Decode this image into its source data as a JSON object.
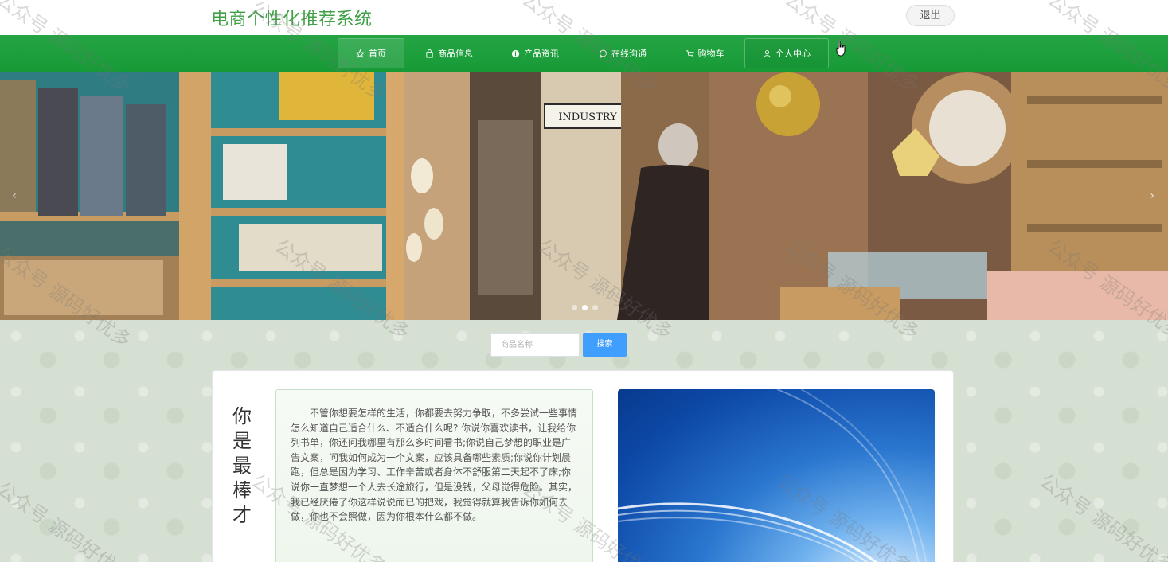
{
  "header": {
    "site_title": "电商个性化推荐系统",
    "logout_label": "退出"
  },
  "nav": {
    "items": [
      {
        "label": "首页",
        "icon": "star-icon",
        "active": true
      },
      {
        "label": "商品信息",
        "icon": "bag-icon"
      },
      {
        "label": "产品资讯",
        "icon": "info-icon"
      },
      {
        "label": "在线沟通",
        "icon": "chat-icon"
      },
      {
        "label": "购物车",
        "icon": "cart-icon"
      },
      {
        "label": "个人中心",
        "icon": "user-icon",
        "boxed": true
      }
    ]
  },
  "banner": {
    "sign_text": "INDUSTRY",
    "prev_glyph": "‹",
    "next_glyph": "›",
    "slide_count": 3,
    "active_slide": 1
  },
  "search": {
    "placeholder": "商品名称",
    "value": "",
    "button_label": "搜索"
  },
  "about": {
    "title_chars": [
      "你",
      "是",
      "最",
      "棒",
      "才"
    ],
    "paragraph": "不管你想要怎样的生活，你都要去努力争取，不多尝试一些事情怎么知道自己适合什么、不适合什么呢? 你说你喜欢读书，让我给你列书单，你还问我哪里有那么多时间看书;你说自己梦想的职业是广告文案，问我如何成为一个文案，应该具备哪些素质;你说你计划晨跑，但总是因为学习、工作辛苦或者身体不舒服第二天起不了床;你说你一直梦想一个人去长途旅行，但是没钱，父母觉得危险。其实，我已经厌倦了你这样说说而已的把戏，我觉得就算我告诉你如何去做，你也不会照做，因为你根本什么都不做。"
  },
  "watermark_text": "公众号 源码好优多",
  "colors": {
    "brand_green": "#3fa046",
    "nav_green": "#169a36",
    "search_blue": "#409eff"
  }
}
